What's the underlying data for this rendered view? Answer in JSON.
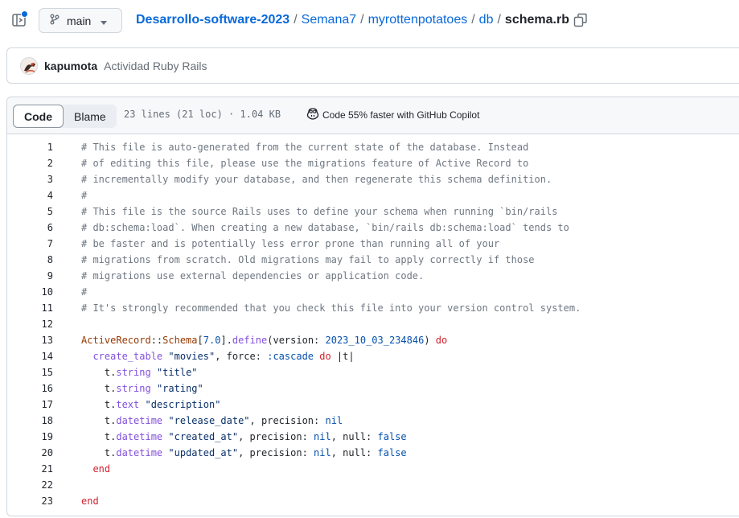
{
  "header": {
    "branch": "main",
    "breadcrumb": {
      "repo": "Desarrollo-software-2023",
      "segments": [
        "Semana7",
        "myrottenpotatoes",
        "db"
      ],
      "separator": "/",
      "file": "schema.rb"
    }
  },
  "commit": {
    "author": "kapumota",
    "message": "Actividad Ruby Rails"
  },
  "file_view": {
    "tabs": [
      "Code",
      "Blame"
    ],
    "active_tab": "Code",
    "info": "23 lines (21 loc) · 1.04 KB",
    "copilot_text": "Code 55% faster with GitHub Copilot"
  },
  "colors": {
    "link": "#0969da",
    "comment": "#6e7781",
    "keyword": "#cf222e",
    "constant": "#953800",
    "function": "#8250df",
    "number": "#0550ae",
    "string": "#0a3069"
  },
  "code_lines": [
    {
      "n": "1",
      "tokens": [
        {
          "t": "comment",
          "v": "# This file is auto-generated from the current state of the database. Instead"
        }
      ]
    },
    {
      "n": "2",
      "tokens": [
        {
          "t": "comment",
          "v": "# of editing this file, please use the migrations feature of Active Record to"
        }
      ]
    },
    {
      "n": "3",
      "tokens": [
        {
          "t": "comment",
          "v": "# incrementally modify your database, and then regenerate this schema definition."
        }
      ]
    },
    {
      "n": "4",
      "tokens": [
        {
          "t": "comment",
          "v": "#"
        }
      ]
    },
    {
      "n": "5",
      "tokens": [
        {
          "t": "comment",
          "v": "# This file is the source Rails uses to define your schema when running `bin/rails"
        }
      ]
    },
    {
      "n": "6",
      "tokens": [
        {
          "t": "comment",
          "v": "# db:schema:load`. When creating a new database, `bin/rails db:schema:load` tends to"
        }
      ]
    },
    {
      "n": "7",
      "tokens": [
        {
          "t": "comment",
          "v": "# be faster and is potentially less error prone than running all of your"
        }
      ]
    },
    {
      "n": "8",
      "tokens": [
        {
          "t": "comment",
          "v": "# migrations from scratch. Old migrations may fail to apply correctly if those"
        }
      ]
    },
    {
      "n": "9",
      "tokens": [
        {
          "t": "comment",
          "v": "# migrations use external dependencies or application code."
        }
      ]
    },
    {
      "n": "10",
      "tokens": [
        {
          "t": "comment",
          "v": "#"
        }
      ]
    },
    {
      "n": "11",
      "tokens": [
        {
          "t": "comment",
          "v": "# It's strongly recommended that you check this file into your version control system."
        }
      ]
    },
    {
      "n": "12",
      "tokens": []
    },
    {
      "n": "13",
      "tokens": [
        {
          "t": "const",
          "v": "ActiveRecord"
        },
        {
          "t": "plain",
          "v": "::"
        },
        {
          "t": "const",
          "v": "Schema"
        },
        {
          "t": "plain",
          "v": "["
        },
        {
          "t": "num",
          "v": "7.0"
        },
        {
          "t": "plain",
          "v": "]."
        },
        {
          "t": "fn",
          "v": "define"
        },
        {
          "t": "plain",
          "v": "(version: "
        },
        {
          "t": "num",
          "v": "2023_10_03_234846"
        },
        {
          "t": "plain",
          "v": ") "
        },
        {
          "t": "kw",
          "v": "do"
        }
      ]
    },
    {
      "n": "14",
      "tokens": [
        {
          "t": "plain",
          "v": "  "
        },
        {
          "t": "fn",
          "v": "create_table"
        },
        {
          "t": "plain",
          "v": " "
        },
        {
          "t": "str",
          "v": "\"movies\""
        },
        {
          "t": "plain",
          "v": ", force: "
        },
        {
          "t": "sym",
          "v": ":cascade"
        },
        {
          "t": "plain",
          "v": " "
        },
        {
          "t": "kw",
          "v": "do"
        },
        {
          "t": "plain",
          "v": " |t|"
        }
      ]
    },
    {
      "n": "15",
      "tokens": [
        {
          "t": "plain",
          "v": "    t."
        },
        {
          "t": "fn",
          "v": "string"
        },
        {
          "t": "plain",
          "v": " "
        },
        {
          "t": "str",
          "v": "\"title\""
        }
      ]
    },
    {
      "n": "16",
      "tokens": [
        {
          "t": "plain",
          "v": "    t."
        },
        {
          "t": "fn",
          "v": "string"
        },
        {
          "t": "plain",
          "v": " "
        },
        {
          "t": "str",
          "v": "\"rating\""
        }
      ]
    },
    {
      "n": "17",
      "tokens": [
        {
          "t": "plain",
          "v": "    t."
        },
        {
          "t": "fn",
          "v": "text"
        },
        {
          "t": "plain",
          "v": " "
        },
        {
          "t": "str",
          "v": "\"description\""
        }
      ]
    },
    {
      "n": "18",
      "tokens": [
        {
          "t": "plain",
          "v": "    t."
        },
        {
          "t": "fn",
          "v": "datetime"
        },
        {
          "t": "plain",
          "v": " "
        },
        {
          "t": "str",
          "v": "\"release_date\""
        },
        {
          "t": "plain",
          "v": ", precision: "
        },
        {
          "t": "num",
          "v": "nil"
        }
      ]
    },
    {
      "n": "19",
      "tokens": [
        {
          "t": "plain",
          "v": "    t."
        },
        {
          "t": "fn",
          "v": "datetime"
        },
        {
          "t": "plain",
          "v": " "
        },
        {
          "t": "str",
          "v": "\"created_at\""
        },
        {
          "t": "plain",
          "v": ", precision: "
        },
        {
          "t": "num",
          "v": "nil"
        },
        {
          "t": "plain",
          "v": ", null: "
        },
        {
          "t": "num",
          "v": "false"
        }
      ]
    },
    {
      "n": "20",
      "tokens": [
        {
          "t": "plain",
          "v": "    t."
        },
        {
          "t": "fn",
          "v": "datetime"
        },
        {
          "t": "plain",
          "v": " "
        },
        {
          "t": "str",
          "v": "\"updated_at\""
        },
        {
          "t": "plain",
          "v": ", precision: "
        },
        {
          "t": "num",
          "v": "nil"
        },
        {
          "t": "plain",
          "v": ", null: "
        },
        {
          "t": "num",
          "v": "false"
        }
      ]
    },
    {
      "n": "21",
      "tokens": [
        {
          "t": "plain",
          "v": "  "
        },
        {
          "t": "kw",
          "v": "end"
        }
      ]
    },
    {
      "n": "22",
      "tokens": []
    },
    {
      "n": "23",
      "tokens": [
        {
          "t": "kw",
          "v": "end"
        }
      ]
    }
  ]
}
